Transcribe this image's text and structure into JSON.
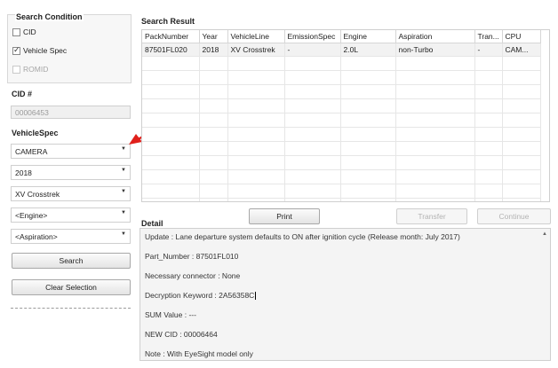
{
  "search_condition": {
    "title": "Search Condition",
    "options": [
      {
        "label": "CID",
        "checked": false,
        "enabled": true
      },
      {
        "label": "Vehicle Spec",
        "checked": true,
        "enabled": true
      },
      {
        "label": "ROMID",
        "checked": false,
        "enabled": false
      }
    ]
  },
  "cid": {
    "label": "CID #",
    "value": "00006453"
  },
  "vehicle_spec": {
    "label": "VehicleSpec",
    "combos": [
      "CAMERA",
      "2018",
      "XV Crosstrek",
      "<Engine>",
      "<Aspiration>"
    ]
  },
  "buttons": {
    "search": "Search",
    "clear": "Clear Selection",
    "print": "Print",
    "transfer": "Transfer",
    "continue": "Continue"
  },
  "result": {
    "title": "Search Result",
    "columns": [
      "PackNumber",
      "Year",
      "VehicleLine",
      "EmissionSpec",
      "Engine",
      "Aspiration",
      "Tran...",
      "CPU"
    ],
    "rows": [
      [
        "87501FL020",
        "2018",
        "XV Crosstrek",
        "-",
        "2.0L",
        "non-Turbo",
        "-",
        "CAM..."
      ]
    ]
  },
  "detail": {
    "title": "Detail",
    "lines": [
      "Update : Lane departure system defaults to ON after ignition cycle (Release month: July   2017)",
      "Part_Number : 87501FL010",
      "Necessary connector : None",
      "Decryption Keyword : 2A56358C",
      "SUM Value : ---",
      "NEW CID : 00006464",
      "Note : With EyeSight model only"
    ]
  },
  "colors": {
    "arrow": "#e0201b"
  }
}
